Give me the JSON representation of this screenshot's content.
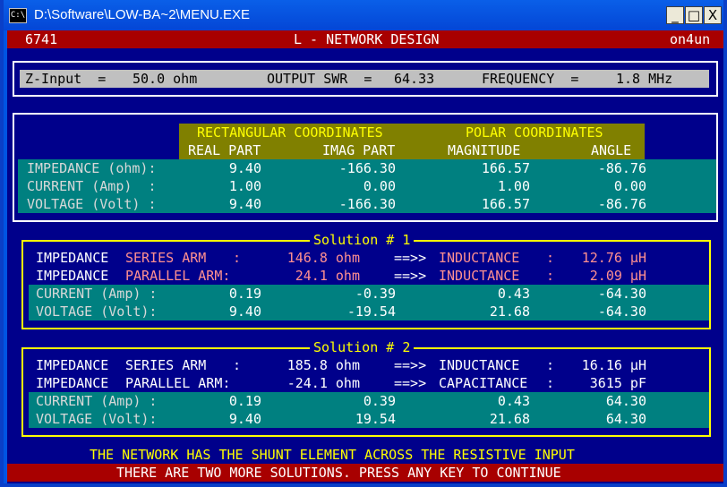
{
  "window": {
    "title": "D:\\Software\\LOW-BA~2\\MENU.EXE",
    "icon_glyph": "C:\\",
    "controls": {
      "minimize": "_",
      "maximize": "□",
      "close": "X"
    }
  },
  "header": {
    "left": "6741",
    "title": "L - NETWORK DESIGN",
    "right": "on4un"
  },
  "status": {
    "zinput_label": "Z-Input  =",
    "zinput_value": "50.0 ohm",
    "swr_label": "OUTPUT SWR  =",
    "swr_value": "64.33",
    "freq_label": "FREQUENCY  =",
    "freq_value": "1.8 MHz"
  },
  "main_table": {
    "group_rect": "RECTANGULAR COORDINATES",
    "group_polar": "POLAR COORDINATES",
    "columns": [
      "REAL PART",
      "IMAG PART",
      "MAGNITUDE",
      "ANGLE"
    ],
    "rows": [
      {
        "label": "IMPEDANCE (ohm):",
        "values": [
          "9.40",
          "-166.30",
          "166.57",
          "-86.76"
        ]
      },
      {
        "label": "CURRENT (Amp)  :",
        "values": [
          "1.00",
          "0.00",
          "1.00",
          "0.00"
        ]
      },
      {
        "label": "VOLTAGE (Volt) :",
        "values": [
          "9.40",
          "-166.30",
          "166.57",
          "-86.76"
        ]
      }
    ]
  },
  "solutions": [
    {
      "title": "Solution # 1",
      "arms": [
        {
          "label": "IMPEDANCE",
          "arm": "SERIES ARM",
          "sep": ":",
          "value": "146.8 ohm",
          "arrow": "==>>",
          "element": "INDUCTANCE",
          "colon": ":",
          "element_value": "12.76 µH"
        },
        {
          "label": "IMPEDANCE",
          "arm": "PARALLEL ARM:",
          "sep": "",
          "value": "24.1 ohm",
          "arrow": "==>>",
          "element": "INDUCTANCE",
          "colon": ":",
          "element_value": "2.09 µH"
        }
      ],
      "rows": [
        {
          "label": "CURRENT (Amp) :",
          "values": [
            "0.19",
            "-0.39",
            "0.43",
            "-64.30"
          ]
        },
        {
          "label": "VOLTAGE (Volt):",
          "values": [
            "9.40",
            "-19.54",
            "21.68",
            "-64.30"
          ]
        }
      ]
    },
    {
      "title": "Solution # 2",
      "arms": [
        {
          "label": "IMPEDANCE",
          "arm": "SERIES ARM",
          "sep": ":",
          "value": "185.8 ohm",
          "arrow": "==>>",
          "element": "INDUCTANCE",
          "colon": ":",
          "element_value": "16.16 µH"
        },
        {
          "label": "IMPEDANCE",
          "arm": "PARALLEL ARM:",
          "sep": "",
          "value": "-24.1 ohm",
          "arrow": "==>>",
          "element": "CAPACITANCE",
          "colon": ":",
          "element_value": "3615 pF"
        }
      ],
      "rows": [
        {
          "label": "CURRENT (Amp) :",
          "values": [
            "0.19",
            "0.39",
            "0.43",
            "64.30"
          ]
        },
        {
          "label": "VOLTAGE (Volt):",
          "values": [
            "9.40",
            "19.54",
            "21.68",
            "64.30"
          ]
        }
      ]
    }
  ],
  "footer": {
    "message": "THE NETWORK HAS THE SHUNT ELEMENT ACROSS THE RESISTIVE INPUT",
    "prompt": "THERE ARE TWO MORE SOLUTIONS. PRESS ANY KEY TO CONTINUE"
  },
  "colors": {
    "screen": "#00008b",
    "header": "#a80000",
    "olive": "#808000",
    "teal": "#008080",
    "yellow": "#ffff00",
    "pink": "#ff9090",
    "status_bar": "#c0c0c0"
  }
}
